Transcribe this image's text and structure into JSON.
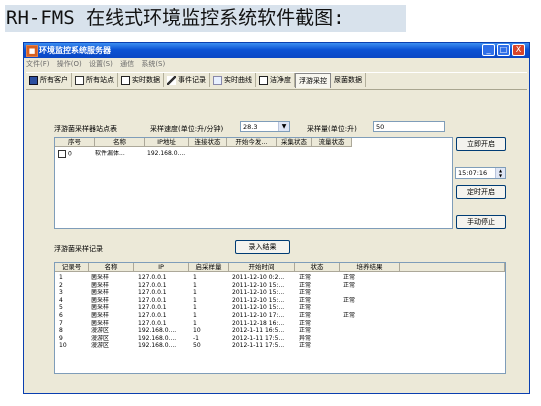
{
  "caption": "RH-FMS 在线式环境监控系统软件截图:",
  "window": {
    "title": "环境监控系统服务器",
    "buttons": {
      "minimize": "_",
      "maximize": "□",
      "close": "X"
    }
  },
  "menu": [
    "文件(F)",
    "操作(O)",
    "设置(S)",
    "通信",
    "系统(S)"
  ],
  "toolbar": [
    {
      "label": "所有客户",
      "icon": "people-icon"
    },
    {
      "label": "所有站点",
      "icon": "site-icon"
    },
    {
      "label": "实时数据",
      "icon": "calculator-icon"
    },
    {
      "label": "事件记录",
      "icon": "pen-icon"
    },
    {
      "label": "实时曲线",
      "icon": "curve-icon"
    },
    {
      "label": "洁净度",
      "icon": "box-icon"
    },
    {
      "label": "浮游采控",
      "icon": ""
    },
    {
      "label": "尿菌数据",
      "icon": ""
    }
  ],
  "sampler": {
    "list_label": "浮游菌采样器站点表",
    "speed_label": "采样速度(单位:升/分钟)",
    "speed_value": "28.3",
    "volume_label": "采样量(单位:升)",
    "volume_value": "50",
    "columns": [
      "序号",
      "名称",
      "IP地址",
      "连接状态",
      "开始今发...",
      "采集状态",
      "流量状态"
    ],
    "rows": [
      {
        "no": "0",
        "name": "软件漏体...",
        "ip": "192.168.0...."
      }
    ]
  },
  "controls": {
    "print_start": "立即开启",
    "time_value": "15:07:16",
    "timed_start": "定时开启",
    "manual_stop": "手动停止"
  },
  "records": {
    "label": "浮游菌采样记录",
    "export_button": "录入结果",
    "columns": [
      "记录号",
      "名称",
      "IP",
      "启采样量",
      "开始时间",
      "状态",
      "培养结果"
    ],
    "rows": [
      [
        "1",
        "菌采样",
        "127.0.0.1",
        "1",
        "2011-12-10 0:2...",
        "正常",
        "正常"
      ],
      [
        "2",
        "菌采样",
        "127.0.0.1",
        "1",
        "2011-12-10 15:...",
        "正常",
        "正常"
      ],
      [
        "3",
        "菌采样",
        "127.0.0.1",
        "1",
        "2011-12-10 15:...",
        "正常",
        ""
      ],
      [
        "4",
        "菌采样",
        "127.0.0.1",
        "1",
        "2011-12-10 15:...",
        "正常",
        "正常"
      ],
      [
        "5",
        "菌采样",
        "127.0.0.1",
        "1",
        "2011-12-10 15:...",
        "正常",
        ""
      ],
      [
        "6",
        "菌采样",
        "127.0.0.1",
        "1",
        "2011-12-10 17:...",
        "正常",
        "正常"
      ],
      [
        "7",
        "菌采样",
        "127.0.0.1",
        "1",
        "2011-12-18 16:...",
        "正常",
        ""
      ],
      [
        "8",
        "漫游区",
        "192.168.0....",
        "10",
        "2012-1-11 16:5...",
        "正常",
        ""
      ],
      [
        "9",
        "漫游区",
        "192.168.0....",
        "-1",
        "2012-1-11 17:5...",
        "异常",
        ""
      ],
      [
        "10",
        "漫游区",
        "192.168.0....",
        "50",
        "2012-1-11 17:5...",
        "正常",
        ""
      ]
    ]
  }
}
